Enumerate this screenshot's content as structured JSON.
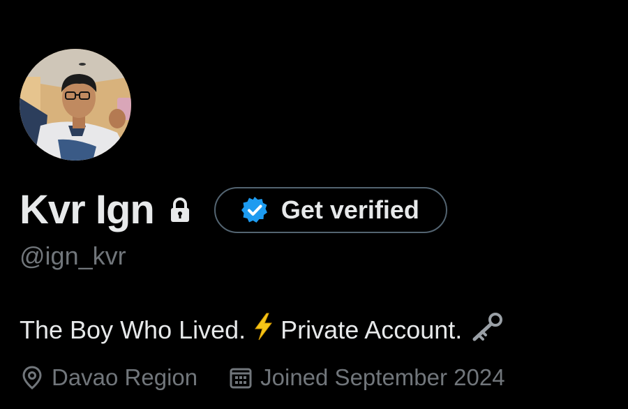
{
  "profile": {
    "display_name": "Kvr Ign",
    "handle": "@ign_kvr",
    "protected_icon": "lock-icon",
    "get_verified_label": "Get verified",
    "verified_badge_icon": "verified-badge-icon",
    "bio_text_1": "The Boy Who Lived.",
    "bio_emoji_1": "⚡",
    "bio_text_2": "Private Account.",
    "bio_emoji_2": "🗝️",
    "location": "Davao Region",
    "location_icon": "location-pin-icon",
    "joined": "Joined September 2024",
    "joined_icon": "calendar-icon"
  },
  "colors": {
    "background": "#000000",
    "primary_text": "#e7e9ea",
    "secondary_text": "#71767b",
    "button_border": "#536471",
    "verified_blue": "#1d9bf0",
    "bolt_yellow": "#f5c518"
  }
}
